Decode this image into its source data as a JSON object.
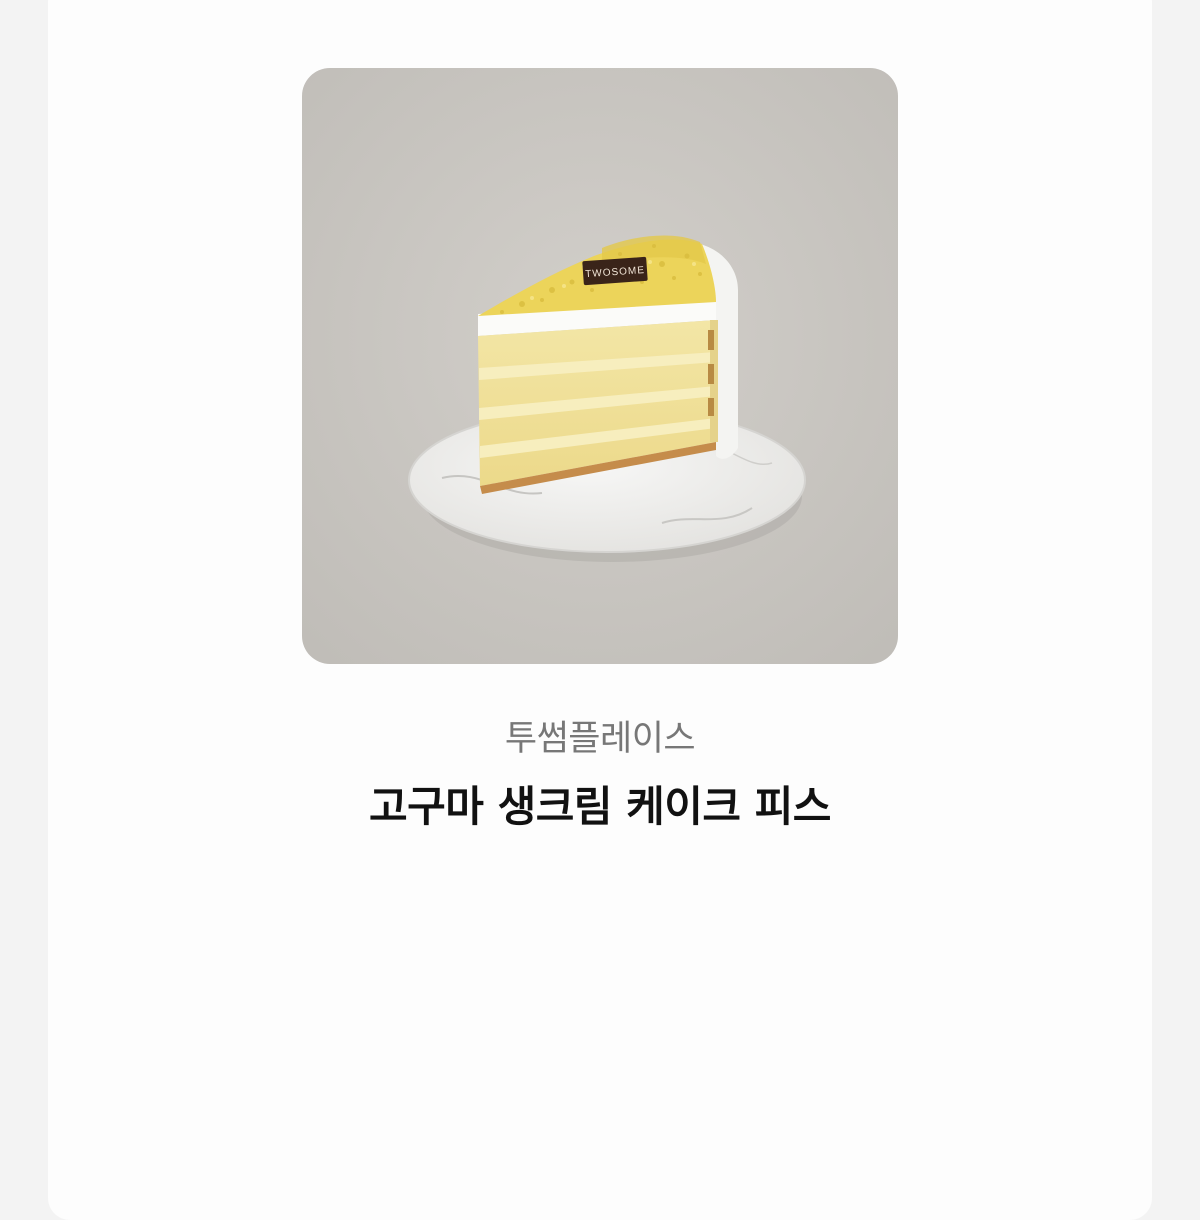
{
  "product": {
    "brand": "투썸플레이스",
    "name": "고구마 생크림 케이크 피스",
    "image": {
      "logo_text": "TWOSOME"
    }
  },
  "colors": {
    "page_background": "#f3f3f3",
    "card_background": "#fdfdfd",
    "brand_text": "#777777",
    "title_text": "#111111",
    "photo_background": "#cbc8c3"
  }
}
